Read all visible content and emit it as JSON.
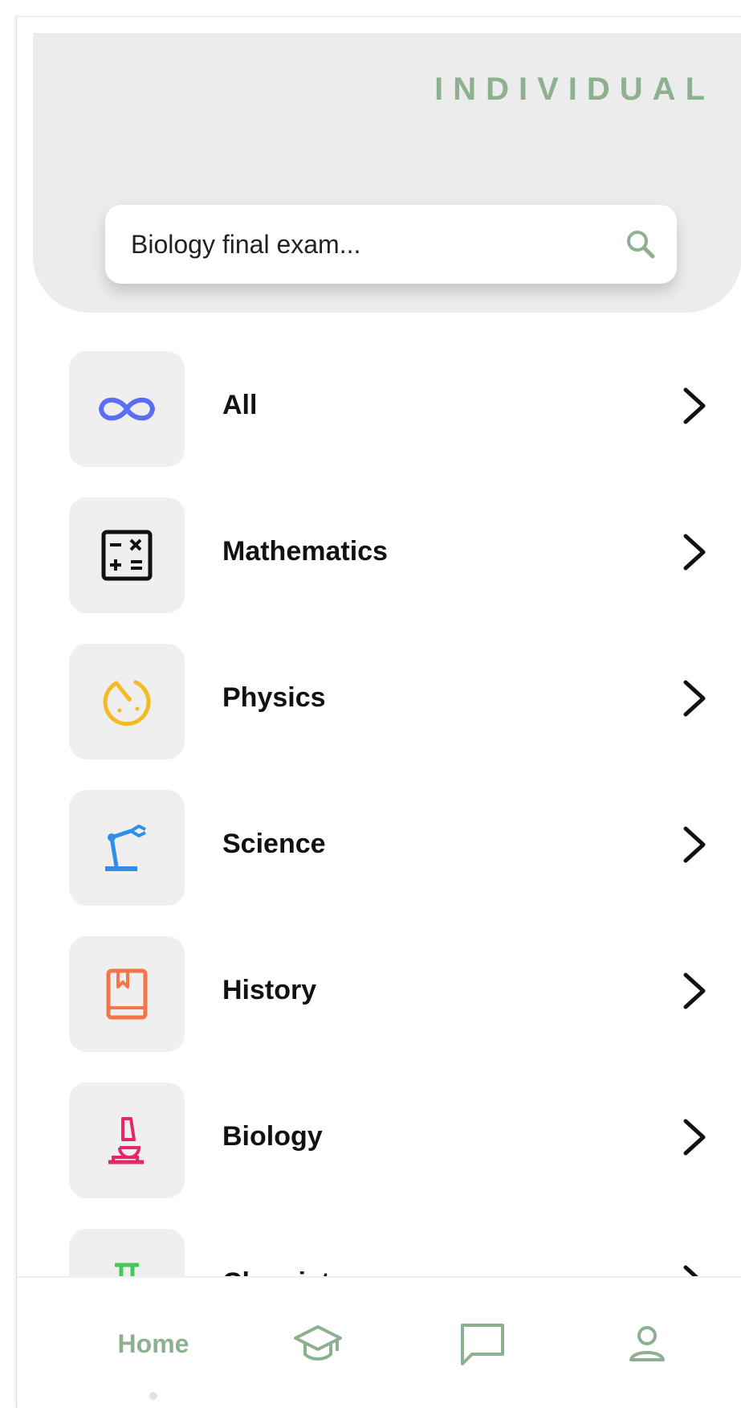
{
  "header": {
    "brand": "INDIVIDUAL"
  },
  "search": {
    "placeholder": "Biology final exam..."
  },
  "subjects": [
    {
      "label": "All",
      "icon": "infinity-icon"
    },
    {
      "label": "Mathematics",
      "icon": "calculator-icon"
    },
    {
      "label": "Physics",
      "icon": "atom-icon"
    },
    {
      "label": "Science",
      "icon": "robot-arm-icon"
    },
    {
      "label": "History",
      "icon": "book-icon"
    },
    {
      "label": "Biology",
      "icon": "microscope-icon"
    },
    {
      "label": "Chemistry",
      "icon": "flask-icon"
    }
  ],
  "bottom_nav": {
    "home_label": "Home",
    "items": [
      "home",
      "courses",
      "messages",
      "profile"
    ]
  },
  "colors": {
    "accent": "#8db08f",
    "header_bg": "#ececec",
    "tile_bg": "#efefef",
    "infinity": "#5b6cf5",
    "physics": "#f5b921",
    "science": "#2f8ee8",
    "history": "#f5754a",
    "biology": "#e8246a",
    "chemistry": "#45c95a"
  }
}
